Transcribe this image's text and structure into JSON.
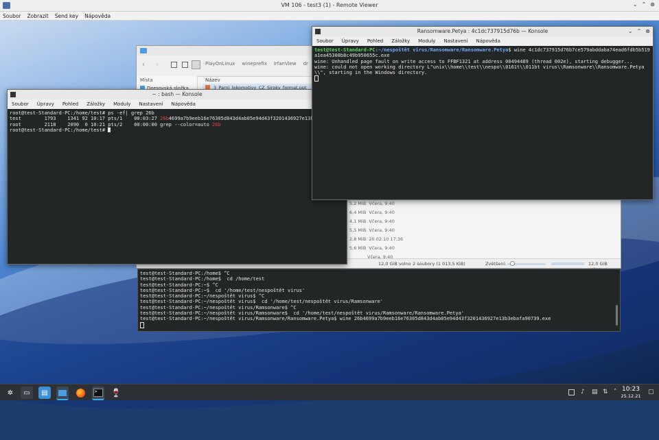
{
  "remote_viewer": {
    "title": "VM 106 - test3 (1) - Remote Viewer",
    "menu": [
      "Soubor",
      "Zobrazit",
      "Send key",
      "Nápověda"
    ]
  },
  "konsole_menu": [
    "Soubor",
    "Úpravy",
    "Pohled",
    "Záložky",
    "Moduly",
    "Nastavení",
    "Nápověda"
  ],
  "file_manager": {
    "breadcrumbs": [
      "PlayOnLinux",
      "wineprefix",
      "IrfanView",
      "dr"
    ],
    "places_header": "Místa",
    "places": [
      "Domovská složka"
    ],
    "column_name": "Název",
    "file_name": "3_Parni_lokomotivy_CZ_Siroky_format.ppt",
    "file_rows": [
      {
        "size": "5,2 MiB",
        "date": "Včera, 9:40"
      },
      {
        "size": "6,4 MiB",
        "date": "Včera, 9:40"
      },
      {
        "size": "4,1 MiB",
        "date": "Včera, 9:40"
      },
      {
        "size": "5,5 MiB",
        "date": "Včera, 9:40"
      },
      {
        "size": "2,8 MiB",
        "date": "20.02.10 17:36"
      },
      {
        "size": "5,6 MiB",
        "date": "Včera, 9:40"
      },
      {
        "size": "",
        "date": "Včera, 9:40"
      }
    ],
    "status_free_left": "12,0 GiB volno",
    "status_selection": "2 soubory (1 013,5 KiB)",
    "zoom_label": "Zvětšení:",
    "status_free_right": "12,0 GiB volno"
  },
  "konsole_bash": {
    "title": "~ : bash — Konsole",
    "lines": [
      "root@test-Standard-PC:/home/test# ps -ef| grep 26b",
      "test        1793    1341 92 10:17 pts/1    00:03:27 ",
      "26b",
      "4699a7b9eeb16e76305d843d4ab05e94d43f3201436927e13b3ebafa90739.exe",
      "root        2118    2090  0 10:21 pts/2    00:00:00 grep --color=auto ",
      "26b",
      "root@test-Standard-PC:/home/test# "
    ]
  },
  "konsole_petya": {
    "title": "Ransomware.Petya : 4c1dc737915d76b — Konsole",
    "prompt": "test@test-Standard-PC",
    "path": ":~/nespoštět virus/Ransomware/Ransomware.Petya",
    "command": "$ wine 4c1dc737915d76b7ce579abddaba74ead6fdb5b519a1ea45308b8c49b950655c.exe",
    "lines": [
      "wine: Unhandled page fault on write access to FFBF1321 at address 00494489 (thread 002e), starting debugger...",
      "wine: could not open working directory L\"unix\\\\home\\\\test\\\\nespo\\\\0161t\\\\011bt virus\\\\Ramsonware\\\\Ransomware.Petya\\\\\", starting in the Windows directory."
    ]
  },
  "bottom_terminal": {
    "lines": [
      "test@test-Standard-PC:/home$ ^C",
      "test@test-Standard-PC:/home$  cd /home/test",
      "test@test-Standard-PC:~$ ^C",
      "test@test-Standard-PC:~$  cd '/home/test/nespoštět virus'",
      "test@test-Standard-PC:~/nespoštět virus$ ^C",
      "test@test-Standard-PC:~/nespoštět virus$  cd '/home/test/nespoštět virus/Ramsonware'",
      "test@test-Standard-PC:~/nespoštět virus/Ramsonware$ ^C",
      "test@test-Standard-PC:~/nespoštět virus/Ramsonware$  cd '/home/test/nespoštět virus/Ramsonware/Ransomware.Petya'",
      "test@test-Standard-PC:~/nespoštět virus/Ramsonware/Ransomware.Petya$ wine 26b4699a7b9eeb16e76305d843d4ab05e94d43f3201436927e13b3ebafa90739.exe"
    ]
  },
  "taskbar": {
    "time": "10:23",
    "date": "25.12.21"
  },
  "colors": {
    "prompt_green": "#5cd65c",
    "path_blue": "#6ea8ff",
    "highlight_red": "#e04545",
    "terminal_bg": "#232627"
  }
}
